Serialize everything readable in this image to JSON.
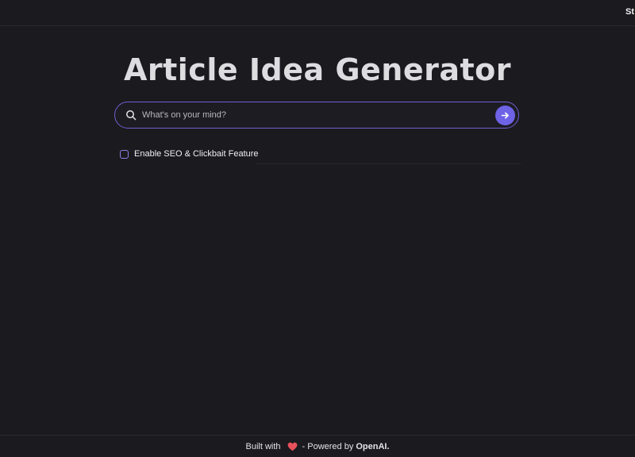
{
  "header": {
    "nav_link": "St"
  },
  "main": {
    "title": "Article Idea Generator",
    "search": {
      "placeholder": "What's on your mind?",
      "value": ""
    },
    "seo_option": {
      "label": "Enable SEO & Clickbait Feature",
      "checked": false
    }
  },
  "footer": {
    "built_with": "Built with",
    "powered_by": "- Powered by",
    "brand": "OpenAI."
  },
  "icons": {
    "search": "search-icon",
    "submit": "arrow-right-icon",
    "heart": "heart-icon"
  },
  "colors": {
    "background": "#1b1a1e",
    "accent": "#6e63e6",
    "border_accent": "#6f5fd3",
    "heart": "#e8515b"
  }
}
